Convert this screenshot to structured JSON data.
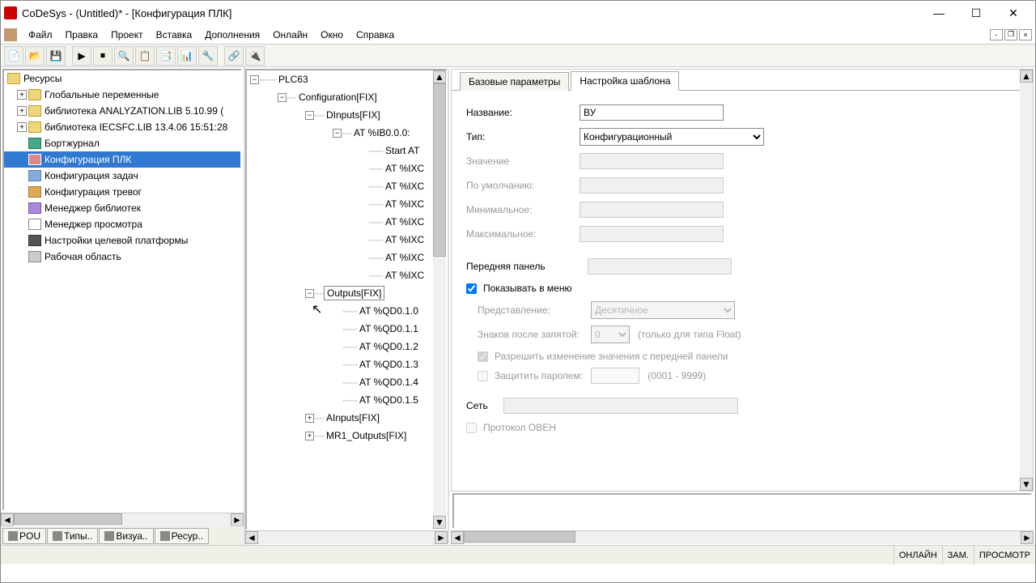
{
  "window": {
    "title": "CoDeSys - (Untitled)* - [Конфигурация ПЛК]"
  },
  "menu": {
    "file": "Файл",
    "edit": "Правка",
    "project": "Проект",
    "insert": "Вставка",
    "extras": "Дополнения",
    "online": "Онлайн",
    "window": "Окно",
    "help": "Справка"
  },
  "resources": {
    "root": "Ресурсы",
    "globals": "Глобальные переменные",
    "lib1": "библиотека ANALYZATION.LIB 5.10.99 (",
    "lib2": "библиотека IECSFC.LIB 13.4.06 15:51:28",
    "log": "Бортжурнал",
    "plc_cfg": "Конфигурация ПЛК",
    "task_cfg": "Конфигурация задач",
    "alarm_cfg": "Конфигурация тревог",
    "lib_mgr": "Менеджер библиотек",
    "view_mgr": "Менеджер просмотра",
    "target": "Настройки целевой платформы",
    "workspace": "Рабочая область"
  },
  "btabs": {
    "pou": "POU",
    "types": "Типы..",
    "visu": "Визуа..",
    "res": "Ресур.."
  },
  "cfg": {
    "root": "PLC63",
    "config": "Configuration[FIX]",
    "dinputs": "DInputs[FIX]",
    "at_ib": "AT %IB0.0.0:",
    "start_at": "Start AT",
    "ixc": "AT %IXC",
    "outputs": "Outputs[FIX]",
    "qd0": "AT %QD0.1.0",
    "qd1": "AT %QD0.1.1",
    "qd2": "AT %QD0.1.2",
    "qd3": "AT %QD0.1.3",
    "qd4": "AT %QD0.1.4",
    "qd5": "AT %QD0.1.5",
    "ainputs": "AInputs[FIX]",
    "mr1": "MR1_Outputs[FIX]"
  },
  "tabs": {
    "base": "Базовые параметры",
    "tpl": "Настройка шаблона"
  },
  "form": {
    "name_l": "Название:",
    "name_v": "ВУ",
    "type_l": "Тип:",
    "type_v": "Конфигурационный",
    "value_l": "Значение",
    "default_l": "По умолчанию:",
    "min_l": "Минимальное:",
    "max_l": "Максимальное:",
    "panel_l": "Передняя панель",
    "show_menu": "Показывать в меню",
    "repr_l": "Представление:",
    "repr_v": "Десятичное",
    "decimals_l": "Знаков после запятой:",
    "decimals_v": "0",
    "decimals_hint": "(только для типа Float)",
    "allow_change": "Разрешить изменение значения с передней панели",
    "protect_l": "Защитить паролем:",
    "protect_hint": "(0001 - 9999)",
    "net_l": "Сеть",
    "owen": "Протокол ОВЕН"
  },
  "status": {
    "online": "ОНЛАЙН",
    "zam": "ЗАМ.",
    "view": "ПРОСМОТР"
  }
}
